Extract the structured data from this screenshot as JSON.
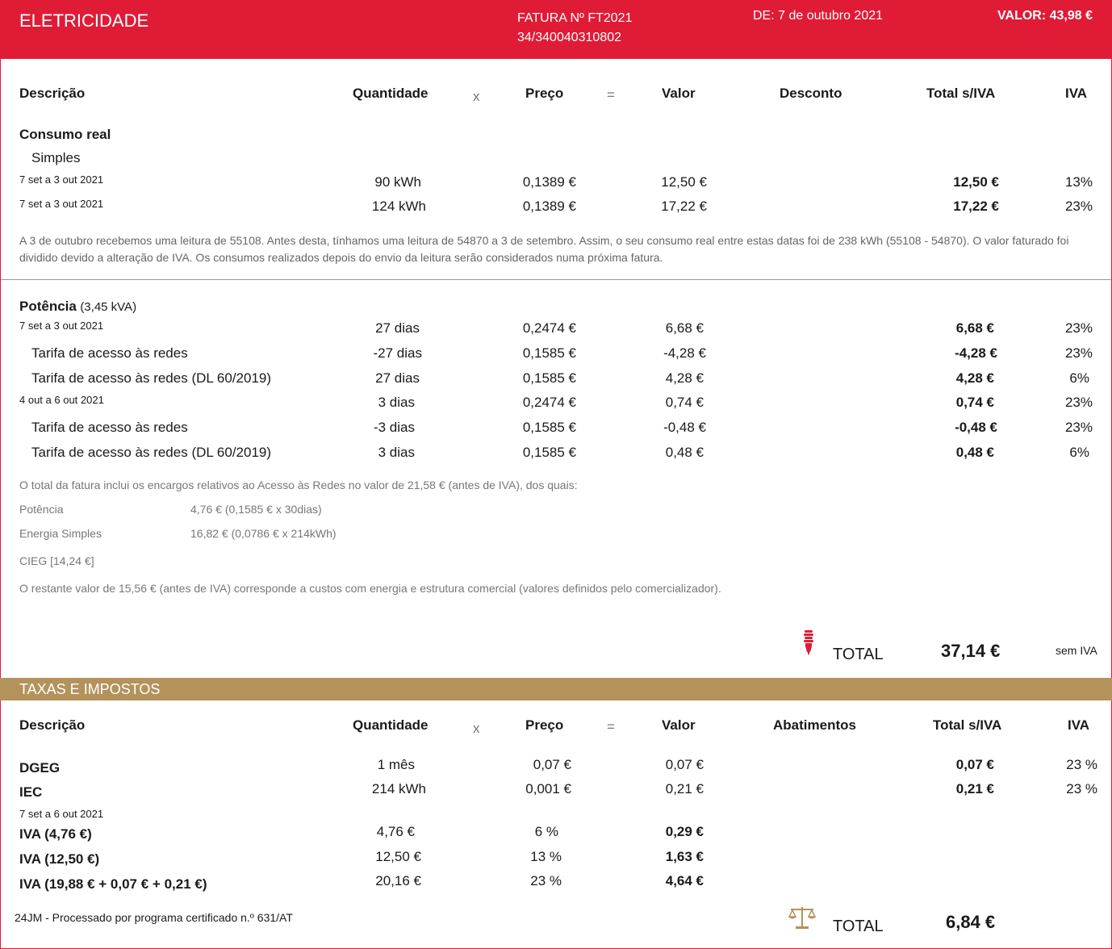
{
  "header": {
    "title": "ELETRICIDADE",
    "invoice_line1": "FATURA Nº FT2021",
    "invoice_line2": "34/340040310802",
    "date": "DE: 7 de outubro 2021",
    "value": "VALOR: 43,98 €"
  },
  "columns": {
    "desc": "Descrição",
    "qty": "Quantidade",
    "times": "x",
    "price": "Preço",
    "equals": "=",
    "value": "Valor",
    "discount": "Desconto",
    "total": "Total s/IVA",
    "vat": "IVA"
  },
  "consumo": {
    "title": "Consumo real",
    "subtitle": "Simples",
    "rows": [
      {
        "period": "7 set a 3 out 2021",
        "qty": "90 kWh",
        "price": "0,1389 €",
        "value": "12,50 €",
        "total": "12,50 €",
        "vat": "13%"
      },
      {
        "period": "7 set a 3 out 2021",
        "qty": "124 kWh",
        "price": "0,1389 €",
        "value": "17,22 €",
        "total": "17,22 €",
        "vat": "23%"
      }
    ],
    "note": "A 3 de outubro recebemos uma leitura de 55108. Antes desta, tínhamos uma leitura de 54870 a 3 de setembro. Assim, o seu consumo real entre estas datas foi de 238 kWh (55108 - 54870). O valor faturado foi dividido devido a alteração de IVA. Os consumos realizados depois do envio da leitura serão considerados numa próxima fatura."
  },
  "potencia": {
    "title": "Potência",
    "power": "(3,45 kVA)",
    "period1": "7 set a 3 out 2021",
    "period2": "4 out a 6 out 2021",
    "rows": [
      {
        "label": "",
        "qty": "27 dias",
        "price": "0,2474 €",
        "value": "6,68 €",
        "total": "6,68 €",
        "vat": "23%"
      },
      {
        "label": "Tarifa de acesso às redes",
        "qty": "-27 dias",
        "price": "0,1585 €",
        "value": "-4,28 €",
        "total": "-4,28 €",
        "vat": "23%"
      },
      {
        "label": "Tarifa de acesso às redes (DL 60/2019)",
        "qty": "27 dias",
        "price": "0,1585 €",
        "value": "4,28 €",
        "total": "4,28 €",
        "vat": "6%"
      },
      {
        "label": "",
        "qty": "3 dias",
        "price": "0,2474 €",
        "value": "0,74 €",
        "total": "0,74 €",
        "vat": "23%"
      },
      {
        "label": "Tarifa de acesso às redes",
        "qty": "-3 dias",
        "price": "0,1585 €",
        "value": "-0,48 €",
        "total": "-0,48 €",
        "vat": "23%"
      },
      {
        "label": "Tarifa de acesso às redes (DL 60/2019)",
        "qty": "3 dias",
        "price": "0,1585 €",
        "value": "0,48 €",
        "total": "0,48 €",
        "vat": "6%"
      }
    ],
    "note1": "O total da fatura inclui os encargos relativos ao Acesso às Redes no valor de 21,58 € (antes de IVA), dos quais:",
    "breakdown": [
      {
        "label": "Potência",
        "value": "4,76 € (0,1585 € x 30dias)"
      },
      {
        "label": "Energia Simples",
        "value": "16,82 € (0,0786 € x 214kWh)"
      }
    ],
    "cieg": "CIEG [14,24 €]",
    "note2": "O restante valor de 15,56 € (antes de IVA) corresponde a custos com energia e estrutura comercial (valores definidos pelo comercializador)."
  },
  "total_elec": {
    "label": "TOTAL",
    "value": "37,14 €",
    "suffix": "sem IVA"
  },
  "taxes": {
    "title": "TAXAS E IMPOSTOS",
    "col_discount": "Abatimentos",
    "rows": [
      {
        "desc": "DGEG",
        "qty": "1 mês",
        "price": "0,07 €",
        "value": "0,07 €",
        "total": "0,07 €",
        "vat": "23 %"
      },
      {
        "desc": "IEC",
        "qty": "214 kWh",
        "price": "0,001 €",
        "value": "0,21 €",
        "total": "0,21 €",
        "vat": "23 %"
      }
    ],
    "period": "7 set a 6 out 2021",
    "iva_rows": [
      {
        "desc": "IVA (4,76 €)",
        "qty": "4,76 €",
        "price": "6 %",
        "value": "0,29 €"
      },
      {
        "desc": "IVA (12,50 €)",
        "qty": "12,50 €",
        "price": "13 %",
        "value": "1,63 €"
      },
      {
        "desc": "IVA (19,88 € + 0,07 € + 0,21 €)",
        "qty": "20,16 €",
        "price": "23 %",
        "value": "4,64 €"
      }
    ],
    "footer": "24JM - Processado por programa certificado n.º 631/AT",
    "total_label": "TOTAL",
    "total_value": "6,84 €"
  },
  "colors": {
    "red": "#e01b36",
    "gold": "#b3925b"
  },
  "icons": {
    "bulb": "lightbulb-icon",
    "scale": "scale-icon"
  }
}
